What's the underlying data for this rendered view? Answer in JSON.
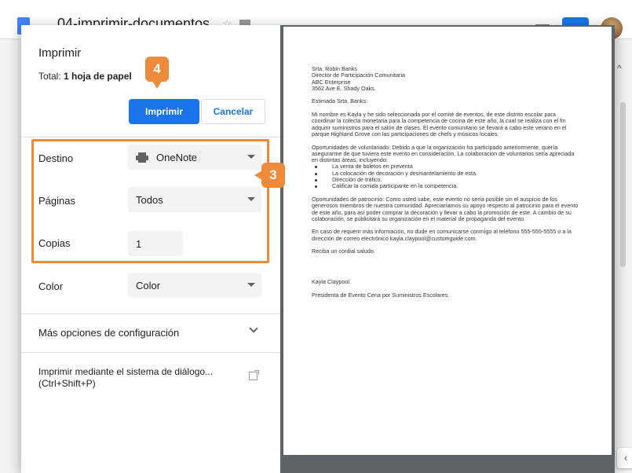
{
  "doc": {
    "title": "04-imprimir-documentos"
  },
  "print_dialog": {
    "title": "Imprimir",
    "total_label": "Total: ",
    "total_value": "1 hoja de papel",
    "print_button": "Imprimir",
    "cancel_button": "Cancelar",
    "destination_label": "Destino",
    "destination_value": "OneNote",
    "pages_label": "Páginas",
    "pages_value": "Todos",
    "copies_label": "Copias",
    "copies_value": "1",
    "color_label": "Color",
    "color_value": "Color",
    "more_options": "Más opciones de configuración",
    "system_dialog": "Imprimir mediante el sistema de diálogo... (Ctrl+Shift+P)"
  },
  "callouts": {
    "step4": "4",
    "step3": "3",
    "accent_color": "#ed8b3a"
  },
  "preview": {
    "address": [
      "Srta. Robin Banks",
      "Director de Participación Comunitaria",
      "ABC Enterprise",
      "3562 Ave E. Shady Oaks."
    ],
    "greeting": "Estimada Srta. Banks:",
    "para1": "Mi nombre es Kayla y he sido seleccionada por el comité de eventos, de este distrito escolar para coordinar la colecta monetaria para la competencia de cocina de este año, la cual se realiza con el fin adquirir suministros para el salón de clases. El evento comunitario se llevará a cabo este verano en el parque Highland Grove con las participaciones de chefs y músicos locales.",
    "para2": "Oportunidades de voluntariado: Debido a que la organización ha participado anteriormente, quería asegurarme de que tuviera este evento en consideración. La colaboración de voluntarios sería apreciada en distintas áreas, incluyendo:",
    "bullets": [
      "La venta de boletos en preventa",
      "La colocación de decoración y desmantelamiento de esta.",
      "Dirección de tráfico.",
      "Calificar la comida participante en la competencia."
    ],
    "para3": "Oportunidades de patrocinio: Como usted sabe, este evento no sería posible sin el auspicio de los generosos miembros de nuestra comunidad. Apreciaríamos su apoyo respecto al patrocinio para el evento de este año, para así poder comprar la decoración y llevar a cabo la promoción de este. A cambio de su colaboración, se publicitará su organización en el material de propaganda del evento.",
    "para4": "En caso de requerir más información, no dude en comunicarse conmigo al teléfono 555-555-5555 o a la dirección de correo electrónico kayla.claypool@customguide.com.",
    "closing": "Reciba un cordial saludo.",
    "signature": "Kayla Claypool.",
    "role": "Presidenta de Evento Cena por Suministros Escolares."
  }
}
